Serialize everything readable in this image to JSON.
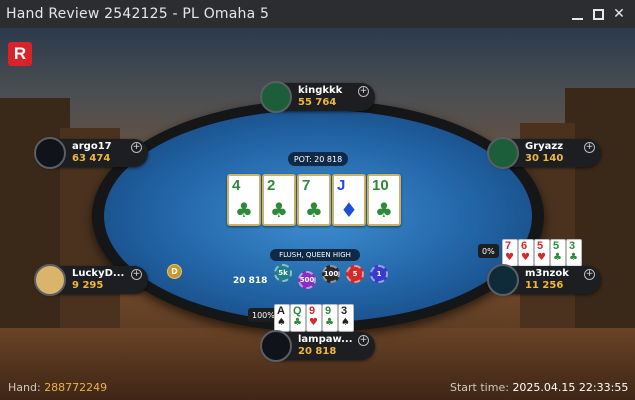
{
  "window": {
    "title": "Hand Review 2542125 - PL Omaha 5",
    "controls": {
      "minimize": "minimize-icon",
      "maximize": "maximize-icon",
      "close": "close-icon"
    }
  },
  "brand": {
    "letter": "R",
    "color": "#d8232a"
  },
  "table": {
    "pot_label": "POT: 20 818",
    "board": [
      {
        "rank": "4",
        "suit": "club"
      },
      {
        "rank": "2",
        "suit": "club"
      },
      {
        "rank": "7",
        "suit": "club"
      },
      {
        "rank": "J",
        "suit": "diamond"
      },
      {
        "rank": "10",
        "suit": "club"
      }
    ],
    "hand_rank": "FLUSH, QUEEN HIGH",
    "bet_amount": "20 818",
    "chips": [
      {
        "label": "5k",
        "color": "#1f7f8a"
      },
      {
        "label": "500",
        "color": "#8a2fc2"
      },
      {
        "label": "100",
        "color": "#2a2a2a"
      },
      {
        "label": "5",
        "color": "#d02a2a"
      },
      {
        "label": "1",
        "color": "#3a3acc"
      }
    ],
    "dealer_label": "D"
  },
  "players": [
    {
      "name": "kingkkk",
      "stack": "55 764"
    },
    {
      "name": "argo17",
      "stack": "63 474"
    },
    {
      "name": "Gryazz",
      "stack": "30 140"
    },
    {
      "name": "LuckyD...",
      "stack": "9 295"
    },
    {
      "name": "m3nzok",
      "stack": "11 256",
      "equity": "0%",
      "cards": [
        {
          "rank": "7",
          "suit": "heart"
        },
        {
          "rank": "6",
          "suit": "heart"
        },
        {
          "rank": "5",
          "suit": "heart"
        },
        {
          "rank": "5",
          "suit": "club"
        },
        {
          "rank": "3",
          "suit": "club"
        }
      ]
    },
    {
      "name": "lampaw...",
      "stack": "20 818",
      "equity": "100%",
      "cards": [
        {
          "rank": "A",
          "suit": "spade"
        },
        {
          "rank": "Q",
          "suit": "club"
        },
        {
          "rank": "9",
          "suit": "heart"
        },
        {
          "rank": "9",
          "suit": "club"
        },
        {
          "rank": "3",
          "suit": "spade"
        }
      ]
    }
  ],
  "footer": {
    "hand_label": "Hand:",
    "hand_id": "288772249",
    "start_label": "Start time:",
    "start_time": "2025.04.15 22:33:55"
  },
  "colors": {
    "felt": "#2366a8",
    "stack_text": "#f1b73a",
    "accent_red": "#d8232a"
  }
}
